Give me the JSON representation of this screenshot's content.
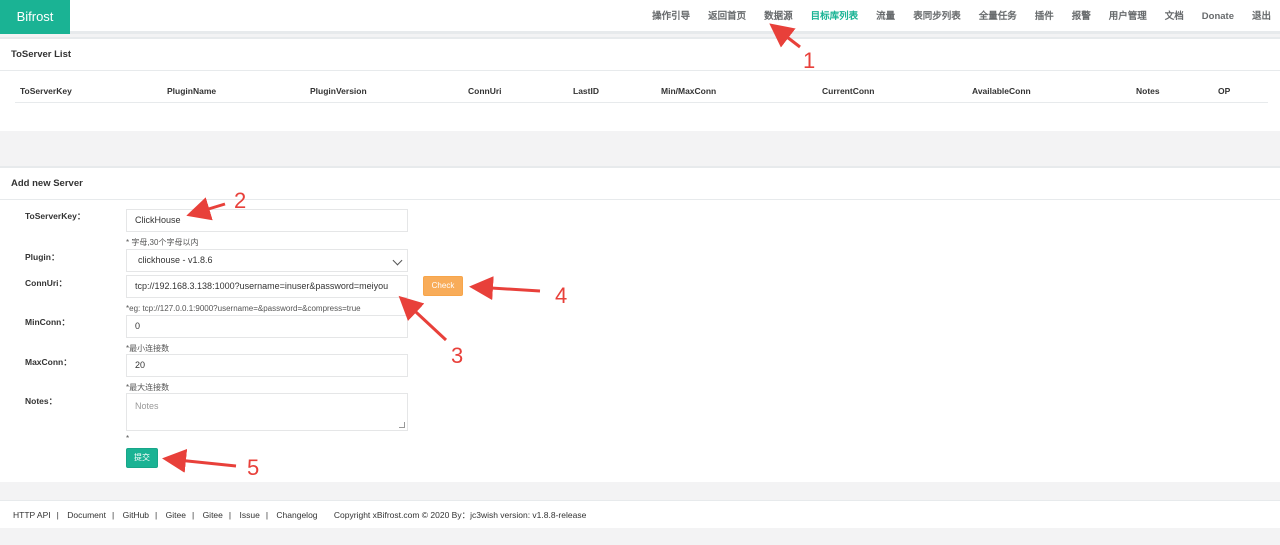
{
  "brand": "Bifrost",
  "nav": [
    {
      "label": "操作引导",
      "active": false
    },
    {
      "label": "返回首页",
      "active": false
    },
    {
      "label": "数据源",
      "active": false
    },
    {
      "label": "目标库列表",
      "active": true
    },
    {
      "label": "流量",
      "active": false
    },
    {
      "label": "表同步列表",
      "active": false
    },
    {
      "label": "全量任务",
      "active": false
    },
    {
      "label": "插件",
      "active": false
    },
    {
      "label": "报警",
      "active": false
    },
    {
      "label": "用户管理",
      "active": false
    },
    {
      "label": "文档",
      "active": false
    },
    {
      "label": "Donate",
      "active": false
    },
    {
      "label": "退出",
      "active": false
    }
  ],
  "list": {
    "title": "ToServer List",
    "columns": [
      "ToServerKey",
      "PluginName",
      "PluginVersion",
      "ConnUri",
      "LastID",
      "Min/MaxConn",
      "CurrentConn",
      "AvailableConn",
      "Notes",
      "OP"
    ]
  },
  "form": {
    "title": "Add new Server",
    "toserverkey": {
      "label": "ToServerKey：",
      "value": "ClickHouse",
      "hint": "* 字母,30个字母以内"
    },
    "plugin": {
      "label": "Plugin：",
      "value": "clickhouse - v1.8.6"
    },
    "connuri": {
      "label": "ConnUri：",
      "value": "tcp://192.168.3.138:1000?username=inuser&password=meiyou",
      "hint": "*eg: tcp://127.0.0.1:9000?username=&password=&compress=true"
    },
    "check_label": "Check",
    "minconn": {
      "label": "MinConn：",
      "value": "0",
      "hint": "*最小连接数"
    },
    "maxconn": {
      "label": "MaxConn：",
      "value": "20",
      "hint": "*最大连接数"
    },
    "notes": {
      "label": "Notes：",
      "placeholder": "Notes",
      "hint": "*"
    },
    "submit_label": "提交"
  },
  "footer": {
    "links": [
      "HTTP API",
      "Document",
      "GitHub",
      "Gitee",
      "Gitee",
      "Issue",
      "Changelog"
    ],
    "copyright": "Copyright  xBifrost.com  © 2020  By：jc3wish  version:  v1.8.8-release"
  },
  "annotations": [
    "1",
    "2",
    "3",
    "4",
    "5"
  ],
  "colors": {
    "accent": "#1ab394",
    "warning": "#f8ac59",
    "annotation": "#e8403a"
  }
}
